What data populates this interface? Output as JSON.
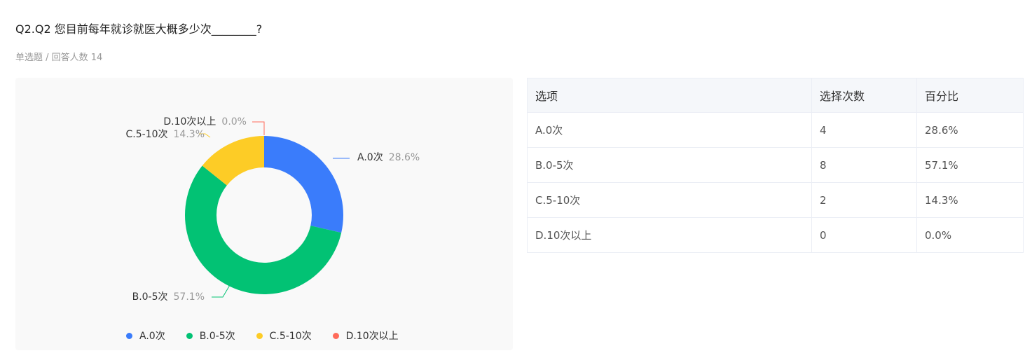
{
  "question": {
    "title": "Q2.Q2 您目前每年就诊就医大概多少次________?",
    "meta": "单选题 / 回答人数 14"
  },
  "colors": {
    "A": "#3a7cfb",
    "B": "#02c274",
    "C": "#fdcc26",
    "D": "#ff6b5a"
  },
  "chart_data": {
    "type": "pie",
    "donut": true,
    "categories": [
      "A.0次",
      "B.0-5次",
      "C.5-10次",
      "D.10次以上"
    ],
    "values": [
      4,
      8,
      2,
      0
    ],
    "percent_labels": [
      "28.6%",
      "57.1%",
      "14.3%",
      "0.0%"
    ],
    "colors": [
      "#3a7cfb",
      "#02c274",
      "#fdcc26",
      "#ff6b5a"
    ],
    "legend_position": "bottom"
  },
  "table": {
    "headers": [
      "选项",
      "选择次数",
      "百分比"
    ],
    "rows": [
      [
        "A.0次",
        "4",
        "28.6%"
      ],
      [
        "B.0-5次",
        "8",
        "57.1%"
      ],
      [
        "C.5-10次",
        "2",
        "14.3%"
      ],
      [
        "D.10次以上",
        "0",
        "0.0%"
      ]
    ]
  }
}
